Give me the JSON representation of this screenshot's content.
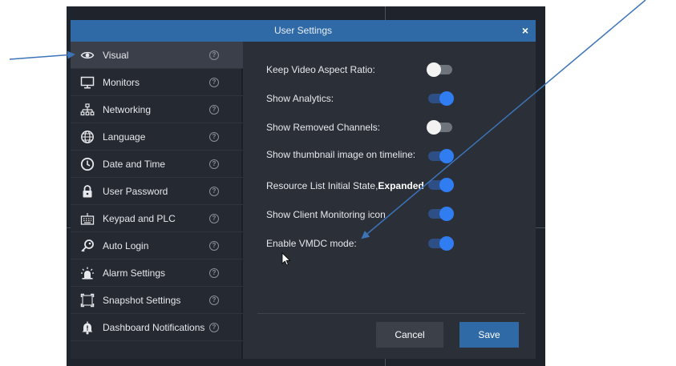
{
  "dialog": {
    "title": "User Settings",
    "close_label": "×"
  },
  "sidebar": {
    "items": [
      {
        "label": "Visual",
        "icon": "eye-icon",
        "active": true
      },
      {
        "label": "Monitors",
        "icon": "monitor-icon"
      },
      {
        "label": "Networking",
        "icon": "network-icon"
      },
      {
        "label": "Language",
        "icon": "globe-icon"
      },
      {
        "label": "Date and Time",
        "icon": "clock-icon"
      },
      {
        "label": "User Password",
        "icon": "lock-icon"
      },
      {
        "label": "Keypad and PLC",
        "icon": "keyboard-icon"
      },
      {
        "label": "Auto Login",
        "icon": "key-icon"
      },
      {
        "label": "Alarm Settings",
        "icon": "siren-icon"
      },
      {
        "label": "Snapshot Settings",
        "icon": "snapshot-icon"
      },
      {
        "label": "Dashboard Notifications",
        "icon": "bell-icon"
      }
    ],
    "help_glyph": "?"
  },
  "settings": {
    "items": [
      {
        "label": "Keep Video Aspect Ratio:",
        "enabled": false
      },
      {
        "label": "Show Analytics:",
        "enabled": true
      },
      {
        "label": "Show Removed Channels:",
        "enabled": false
      },
      {
        "label": "Show thumbnail image on timeline:",
        "enabled": true
      },
      {
        "label": "Resource List Initial State,",
        "label_bold": "Expanded",
        "enabled": true
      },
      {
        "label": "Show Client Monitoring icon",
        "enabled": true
      },
      {
        "label": "Enable VMDC mode:",
        "enabled": true
      }
    ]
  },
  "footer": {
    "cancel_label": "Cancel",
    "save_label": "Save"
  },
  "colors": {
    "titlebar": "#2f6aa6",
    "dialog_bg": "#2b2f37",
    "sidebar_bg": "#252931",
    "active_item": "#3a3f49",
    "toggle_on": "#2f7df0",
    "toggle_off_knob": "#f2f2f2",
    "annotation_arrow": "#3d74b8"
  }
}
